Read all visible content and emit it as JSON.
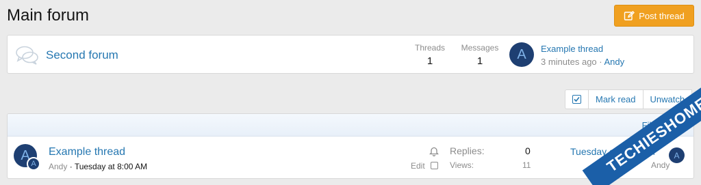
{
  "header": {
    "title": "Main forum",
    "post_thread_label": "Post thread"
  },
  "node": {
    "title": "Second forum",
    "threads_label": "Threads",
    "threads_value": "1",
    "messages_label": "Messages",
    "messages_value": "1",
    "avatar_letter": "A",
    "last_post_title": "Example thread",
    "last_post_time": "3 minutes ago",
    "last_post_separator": " · ",
    "last_post_user": "Andy"
  },
  "actions": {
    "mark_read": "Mark read",
    "unwatch": "Unwatch"
  },
  "thread_list": {
    "filters_label": "Filters",
    "thread": {
      "avatar_letter": "A",
      "title": "Example thread",
      "author": "Andy",
      "meta_separator": " · ",
      "date": "Tuesday at 8:00 AM",
      "edit_label": "Edit",
      "replies_label": "Replies:",
      "replies_value": "0",
      "views_label": "Views:",
      "views_value": "11",
      "last_date": "Tuesday at 8:00 AM",
      "last_user": "Andy",
      "last_avatar_letter": "A"
    }
  },
  "watermark": "TECHIESHOME.COM",
  "colors": {
    "accent": "#2577b1",
    "post_button": "#f0a020",
    "avatar_bg": "#1e3f72"
  }
}
